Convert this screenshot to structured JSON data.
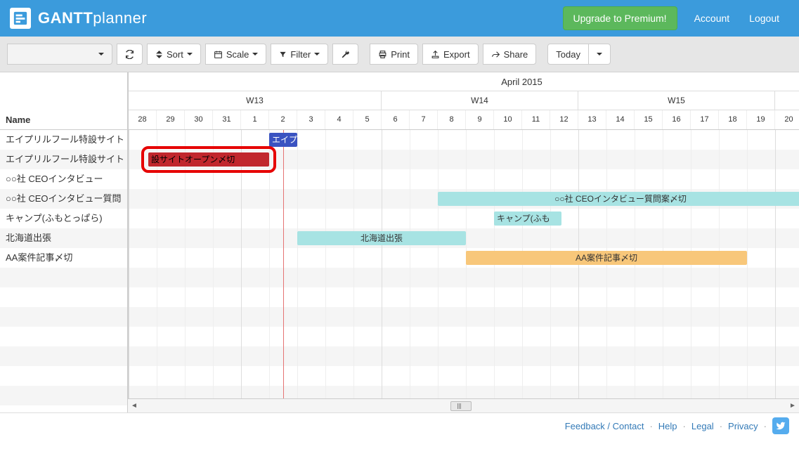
{
  "brand": {
    "bold": "GANTT",
    "light": "planner"
  },
  "topbar": {
    "upgrade": "Upgrade to Premium!",
    "account": "Account",
    "logout": "Logout"
  },
  "toolbar": {
    "sort": "Sort",
    "scale": "Scale",
    "filter": "Filter",
    "print": "Print",
    "export": "Export",
    "share": "Share",
    "today": "Today"
  },
  "sidebar": {
    "header": "Name",
    "tasks": [
      "エイプリルフール特設サイト",
      "エイプリルフール特設サイト",
      "○○社 CEOインタビュー",
      "○○社 CEOインタビュー質問",
      "キャンプ(ふもとっぱら)",
      "北海道出張",
      "AA案件記事〆切"
    ]
  },
  "timeline": {
    "month_label": "April 2015",
    "weeks": [
      "W13",
      "W14",
      "W15"
    ],
    "days": [
      28,
      29,
      30,
      31,
      1,
      2,
      3,
      4,
      5,
      6,
      7,
      8,
      9,
      10,
      11,
      12,
      13,
      14,
      15,
      16,
      17,
      18,
      19,
      20
    ],
    "day_width": 40,
    "today_index": 5.5,
    "month_start_index": 4
  },
  "bars": [
    {
      "row": 0,
      "start": 5,
      "span": 1,
      "label": "エイプ",
      "color": "blue"
    },
    {
      "row": 1,
      "start": 0.7,
      "span": 4.3,
      "label": "設サイトオープン〆切",
      "color": "red",
      "highlighted": true
    },
    {
      "row": 3,
      "start": 11,
      "span": 13,
      "label": "○○社 CEOインタビュー質問案〆切",
      "color": "teal",
      "center": true
    },
    {
      "row": 4,
      "start": 13,
      "span": 2.4,
      "label": "キャンプ(ふも",
      "color": "teal"
    },
    {
      "row": 5,
      "start": 6,
      "span": 6,
      "label": "北海道出張",
      "color": "teal",
      "center": true
    },
    {
      "row": 6,
      "start": 12,
      "span": 10,
      "label": "AA案件記事〆切",
      "color": "orange",
      "center": true
    }
  ],
  "footer": {
    "feedback": "Feedback / Contact",
    "help": "Help",
    "legal": "Legal",
    "privacy": "Privacy"
  },
  "chart_data": {
    "type": "gantt",
    "title": "April 2015",
    "time_unit": "day",
    "start_date": "2015-03-28",
    "tasks": [
      {
        "name": "エイプリルフール特設サイト",
        "start": "2015-04-02",
        "end": "2015-04-02",
        "color": "#3a53c1"
      },
      {
        "name": "エイプリルフール特設サイト 設サイトオープン〆切",
        "start": "2015-03-28",
        "end": "2015-04-01",
        "color": "#c1272d"
      },
      {
        "name": "○○社 CEOインタビュー",
        "start": null,
        "end": null
      },
      {
        "name": "○○社 CEOインタビュー質問案〆切",
        "start": "2015-04-08",
        "end": "2015-04-20",
        "color": "#a7e3e3"
      },
      {
        "name": "キャンプ(ふもとっぱら)",
        "start": "2015-04-10",
        "end": "2015-04-12",
        "color": "#a7e3e3"
      },
      {
        "name": "北海道出張",
        "start": "2015-04-03",
        "end": "2015-04-08",
        "color": "#a7e3e3"
      },
      {
        "name": "AA案件記事〆切",
        "start": "2015-04-09",
        "end": "2015-04-18",
        "color": "#f8c77a"
      }
    ],
    "today": "2015-04-02"
  }
}
